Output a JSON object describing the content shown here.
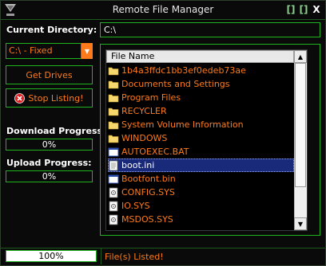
{
  "window": {
    "title": "Remote File Manager",
    "maximize_glyph": "[]",
    "restore_glyph": "[]",
    "close_glyph": "X"
  },
  "left": {
    "current_dir_label": "Current Directory:",
    "drive_select": {
      "value": "C:\\ - Fixed"
    },
    "get_drives": "Get Drives",
    "stop_listing": "Stop Listing!",
    "download_label": "Download Progress:",
    "download_value": "0%",
    "upload_label": "Upload Progress:",
    "upload_value": "0%"
  },
  "path": {
    "value": "C:\\"
  },
  "list": {
    "header": "File Name",
    "items": [
      {
        "name": "1b4a3ffdc1bb3ef0edeb73ae",
        "type": "folder"
      },
      {
        "name": "Documents and Settings",
        "type": "folder"
      },
      {
        "name": "Program Files",
        "type": "folder"
      },
      {
        "name": "RECYCLER",
        "type": "folder"
      },
      {
        "name": "System Volume Information",
        "type": "folder"
      },
      {
        "name": "WINDOWS",
        "type": "folder"
      },
      {
        "name": "AUTOEXEC.BAT",
        "type": "file-window"
      },
      {
        "name": "boot.ini",
        "type": "file-ini",
        "selected": true
      },
      {
        "name": "Bootfont.bin",
        "type": "file-window"
      },
      {
        "name": "CONFIG.SYS",
        "type": "file-sys"
      },
      {
        "name": "IO.SYS",
        "type": "file-sys"
      },
      {
        "name": "MSDOS.SYS",
        "type": "file-sys"
      }
    ]
  },
  "status": {
    "progress": "100%",
    "message": "File(s) Listed!"
  },
  "colors": {
    "accent": "#ff7a1a",
    "border": "#1fb31f",
    "background": "#0a0a0a",
    "selection": "#1a2a7a"
  }
}
